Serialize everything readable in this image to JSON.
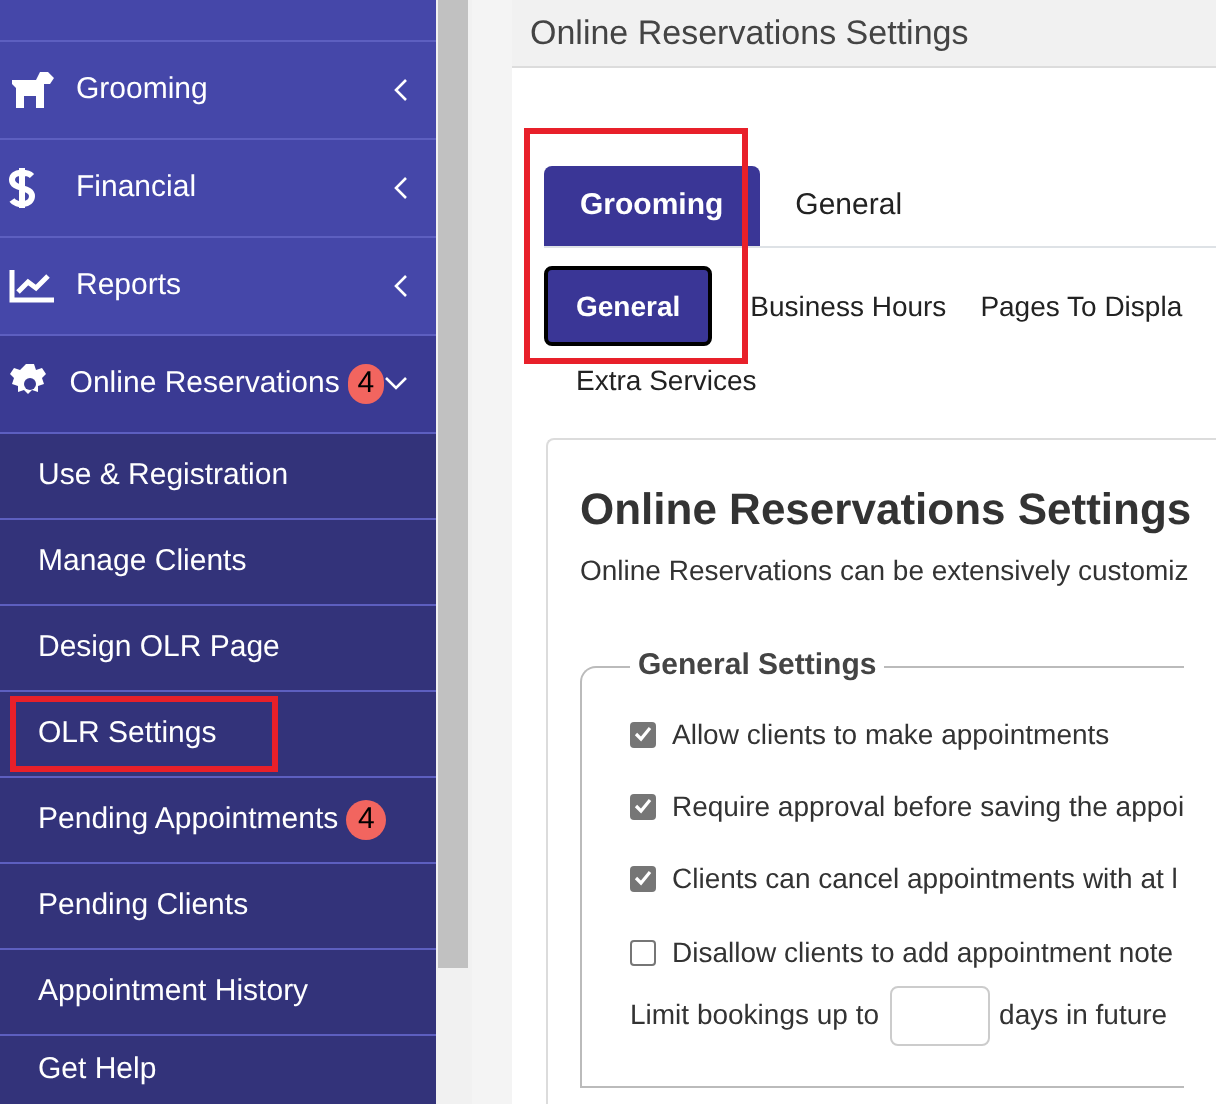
{
  "sidebar": {
    "items": [
      {
        "label": "Grooming",
        "expanded": false
      },
      {
        "label": "Financial",
        "expanded": false
      },
      {
        "label": "Reports",
        "expanded": false
      },
      {
        "label": "Online Reservations",
        "expanded": true,
        "badge": "4",
        "children": [
          {
            "label": "Use & Registration",
            "highlighted": false
          },
          {
            "label": "Manage Clients",
            "highlighted": false
          },
          {
            "label": "Design OLR Page",
            "highlighted": false
          },
          {
            "label": "OLR Settings",
            "highlighted": true
          },
          {
            "label": "Pending Appointments",
            "highlighted": false,
            "badge": "4"
          },
          {
            "label": "Pending Clients",
            "highlighted": false
          },
          {
            "label": "Appointment History",
            "highlighted": false
          },
          {
            "label": "Get Help",
            "highlighted": false
          }
        ]
      }
    ]
  },
  "page": {
    "title": "Online Reservations Settings",
    "tabs": [
      {
        "label": "Grooming",
        "selected": true
      },
      {
        "label": "General",
        "selected": false
      }
    ],
    "subtabs": [
      {
        "label": "General",
        "selected": true
      },
      {
        "label": "Business Hours",
        "selected": false
      },
      {
        "label": "Pages To Displa",
        "selected": false
      },
      {
        "label": "Extra Services",
        "selected": false
      }
    ],
    "heading": "Online Reservations Settings",
    "description": "Online Reservations can be extensively customiz",
    "fieldset": {
      "legend": "General Settings",
      "options": [
        {
          "label": "Allow clients to make appointments",
          "checked": true
        },
        {
          "label": "Require approval before saving the appoi",
          "checked": true
        },
        {
          "label": "Clients can cancel appointments with at l",
          "checked": true
        },
        {
          "label": "Disallow clients to add appointment note",
          "checked": false
        }
      ],
      "limit": {
        "before": "Limit bookings up to",
        "after": "days in future"
      }
    }
  }
}
